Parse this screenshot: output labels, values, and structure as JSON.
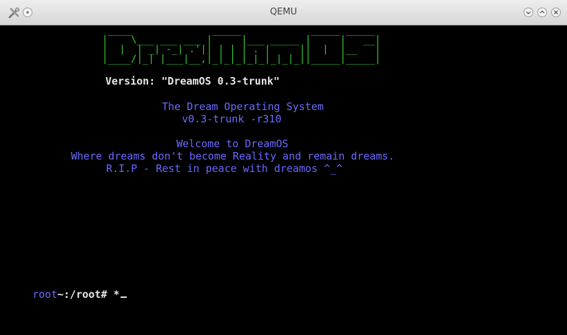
{
  "window": {
    "title": "QEMU",
    "icons": [
      "app-tools-icon",
      "pin-icon",
      "minimize-icon",
      "maximize-icon",
      "close-icon"
    ]
  },
  "terminal": {
    "banner_art": " ____              _____            _____ _____\n|    \\___ ___ ___ |     |___ _____ |     |   __|\n|  |  | _| -_| .'|| | | | . |     ||  |  |__   |\n|____/|_| |___|__,|_|_|_|_|_|_|_|_||_____|_____|",
    "version_line": "Version: \"DreamOS 0.3-trunk\"",
    "subtitle": "The Dream Operating System",
    "revision": "v0.3-trunk -r310",
    "welcome": "Welcome to DreamOS",
    "tagline": "Where dreams don't become Reality and remain dreams.",
    "rip": "R.I.P - Rest in peace with dreamos ^_^",
    "prompt_user": "root",
    "prompt_path": "~:/root# ",
    "input_text": "*"
  },
  "colors": {
    "ascii_green": "#33cc33",
    "text_blue": "#6a6aff",
    "text_white": "#e6e6e6",
    "background": "#000000"
  }
}
